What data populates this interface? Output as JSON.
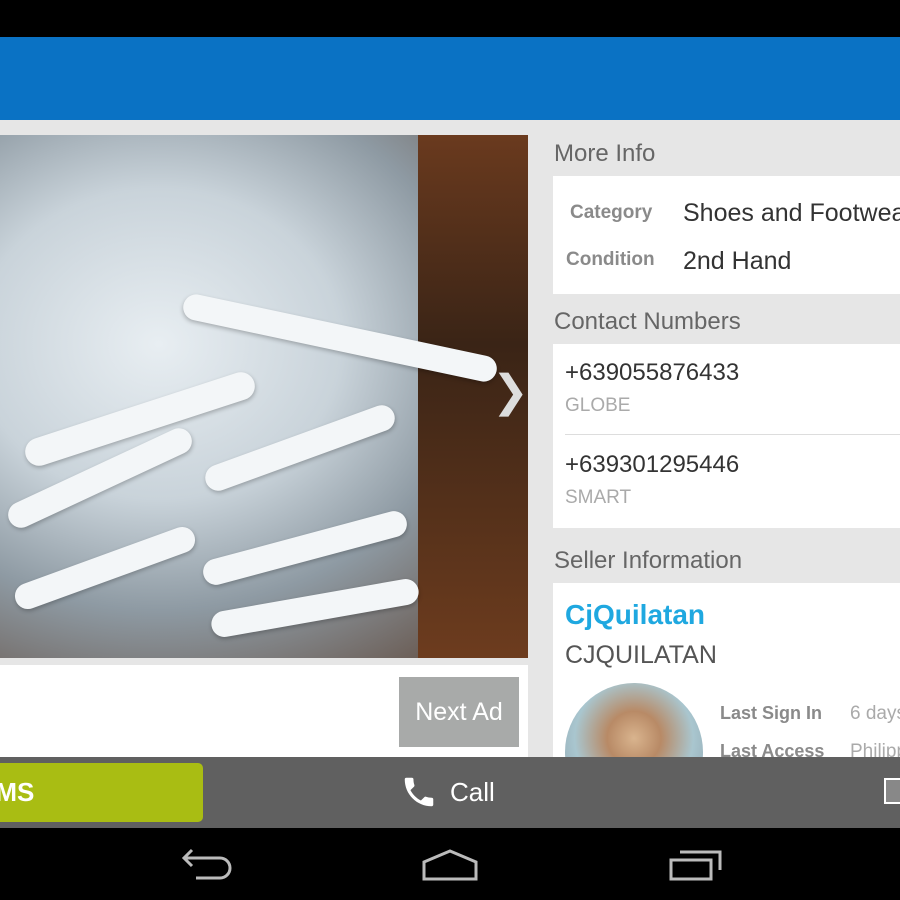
{
  "listing": {
    "next_ad_label": "Next Ad"
  },
  "more_info": {
    "title": "More Info",
    "rows": [
      {
        "label": "Category",
        "value": "Shoes and Footwear"
      },
      {
        "label": "Condition",
        "value": "2nd Hand"
      }
    ]
  },
  "contacts": {
    "title": "Contact Numbers",
    "items": [
      {
        "number": "+639055876433",
        "carrier": "GLOBE"
      },
      {
        "number": "+639301295446",
        "carrier": "SMART"
      }
    ]
  },
  "seller": {
    "title": "Seller Information",
    "name": "CjQuilatan",
    "username": "CJQUILATAN",
    "last_sign_in_label": "Last Sign In",
    "last_sign_in_value": "6 days",
    "last_access_label": "Last Access",
    "last_access_value": "Philippines"
  },
  "actions": {
    "sms": "SMS",
    "call": "Call"
  },
  "colors": {
    "appbar": "#0a72c4",
    "sms": "#a9bd13",
    "link": "#1fa8e0"
  }
}
